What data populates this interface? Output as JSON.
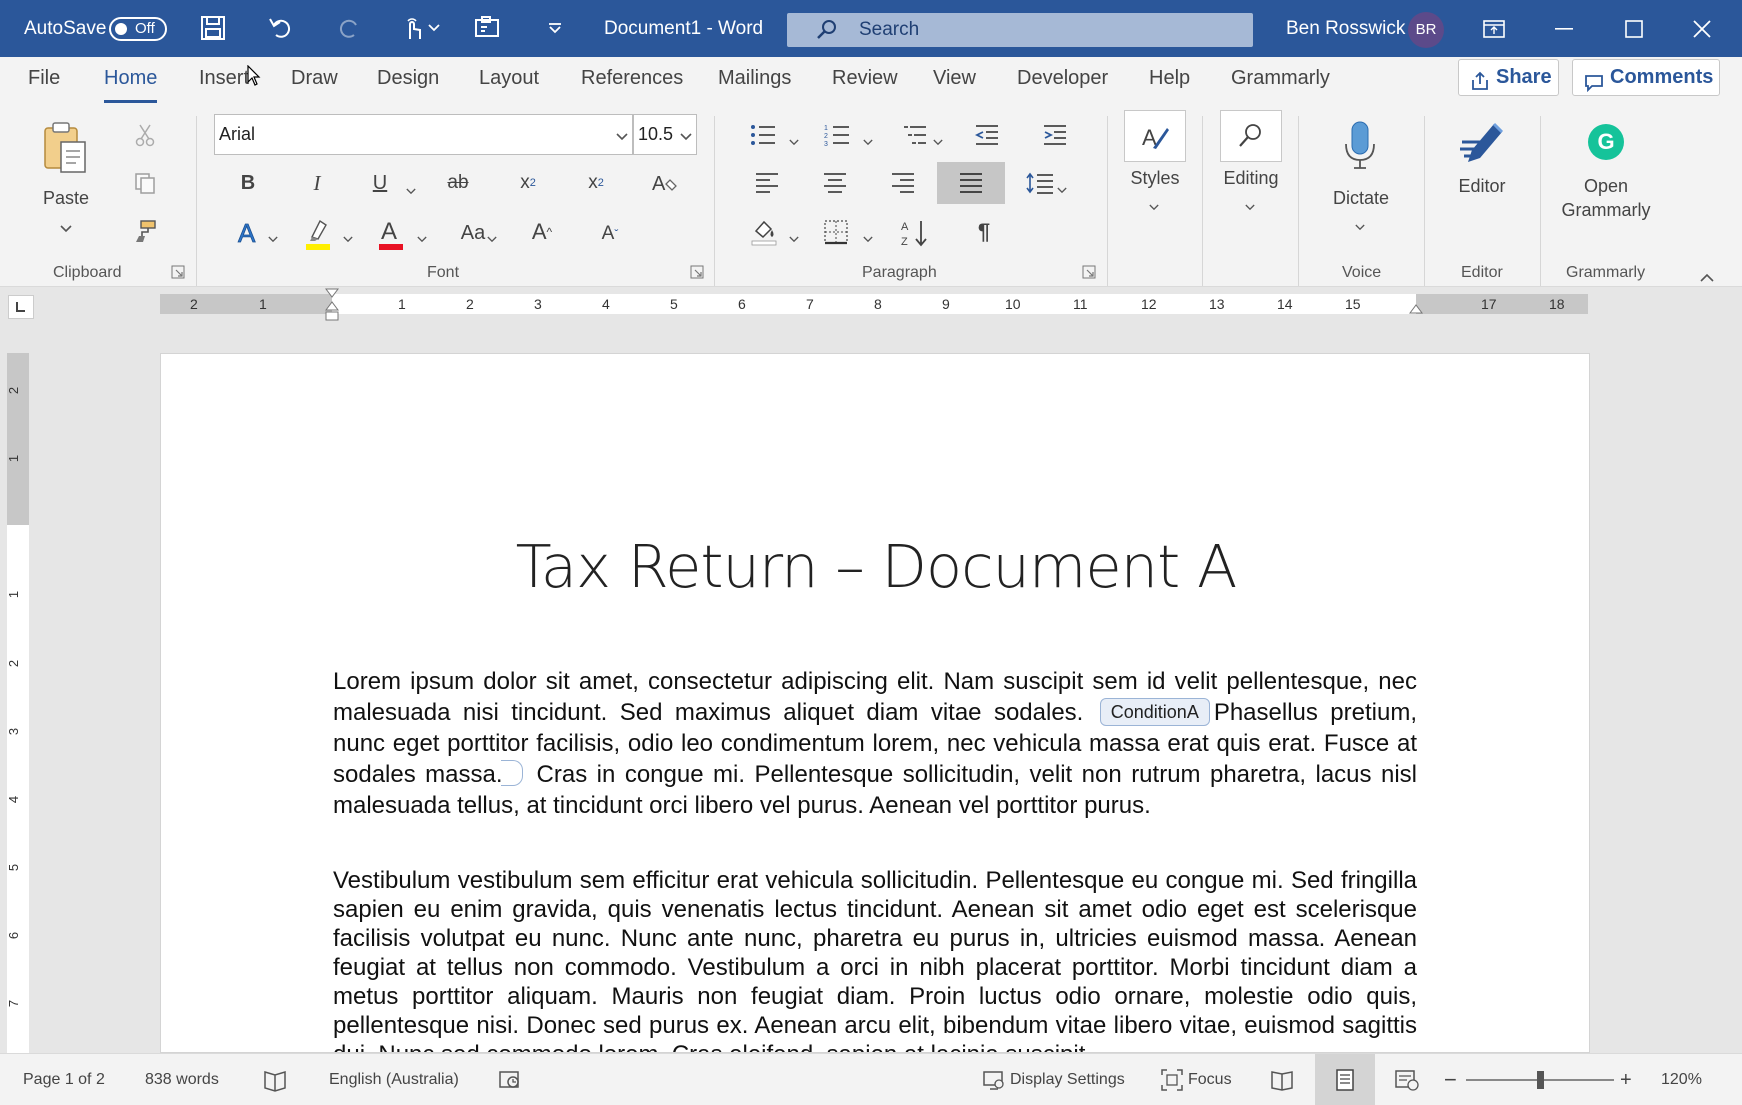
{
  "titlebar": {
    "autosave_label": "AutoSave",
    "autosave_state": "Off",
    "document_title": "Document1  -  Word",
    "search_placeholder": "Search",
    "user_name": "Ben Rosswick",
    "user_initials": "BR",
    "accent_color": "#2b579a"
  },
  "menu": {
    "tabs": [
      "File",
      "Home",
      "Insert",
      "Draw",
      "Design",
      "Layout",
      "References",
      "Mailings",
      "Review",
      "View",
      "Developer",
      "Help",
      "Grammarly"
    ],
    "active_tab": "Home",
    "share_label": "Share",
    "comments_label": "Comments"
  },
  "ribbon": {
    "clipboard": {
      "paste_label": "Paste",
      "group_label": "Clipboard"
    },
    "font": {
      "font_name": "Arial",
      "font_size": "10.5",
      "group_label": "Font",
      "font_color": "#e81123",
      "highlight_color": "#ffef00"
    },
    "paragraph": {
      "group_label": "Paragraph"
    },
    "styles": {
      "styles_label": "Styles",
      "editing_label": "Editing"
    },
    "voice": {
      "dictate_label": "Dictate",
      "group_label": "Voice"
    },
    "editor": {
      "editor_label": "Editor",
      "group_label": "Editor"
    },
    "grammarly": {
      "open_label_1": "Open",
      "open_label_2": "Grammarly",
      "group_label": "Grammarly"
    }
  },
  "ruler": {
    "horizontal_left_labels": [
      "2",
      "1"
    ],
    "horizontal_labels": [
      "1",
      "2",
      "3",
      "4",
      "5",
      "6",
      "7",
      "8",
      "9",
      "10",
      "11",
      "12",
      "13",
      "14",
      "15",
      "17",
      "18"
    ],
    "vertical_labels": [
      "2",
      "1",
      "1",
      "2",
      "3",
      "4",
      "5",
      "6",
      "7"
    ]
  },
  "document": {
    "title": "Tax Return – Document A",
    "para1_a": "Lorem ipsum dolor sit amet, consectetur adipiscing elit. Nam suscipit sem id velit pellentesque, nec malesuada nisi tincidunt. Sed maximus aliquet diam vitae sodales.",
    "content_control_tag": "ConditionA",
    "para1_b": "Phasellus pretium, nunc eget porttitor facilisis, odio leo condimentum lorem, nec vehicula massa erat quis erat. Fusce at sodales massa.",
    "para1_c": "Cras in congue mi. Pellentesque sollicitudin, velit non rutrum pharetra, lacus nisl malesuada tellus, at tincidunt orci libero vel purus. Aenean vel porttitor purus.",
    "para2": "Vestibulum vestibulum sem efficitur erat vehicula sollicitudin. Pellentesque eu congue mi. Sed fringilla sapien eu enim gravida, quis venenatis lectus tincidunt. Aenean sit amet odio eget est scelerisque facilisis volutpat eu nunc. Nunc ante nunc, pharetra eu purus in, ultricies euismod massa. Aenean feugiat at tellus non commodo. Vestibulum a orci in nibh placerat porttitor. Morbi tincidunt diam a metus porttitor aliquam. Mauris non feugiat diam. Proin luctus odio ornare, molestie odio quis, pellentesque nisi. Donec sed purus ex. Aenean arcu elit, bibendum vitae libero vitae, euismod sagittis dui. Nunc sed commodo lorem. Cras eleifend, sapien at lacinia suscipit,"
  },
  "statusbar": {
    "page": "Page 1 of 2",
    "words": "838 words",
    "language": "English (Australia)",
    "display_settings": "Display Settings",
    "focus": "Focus",
    "zoom": "120%",
    "zoom_fraction": 0.5
  }
}
